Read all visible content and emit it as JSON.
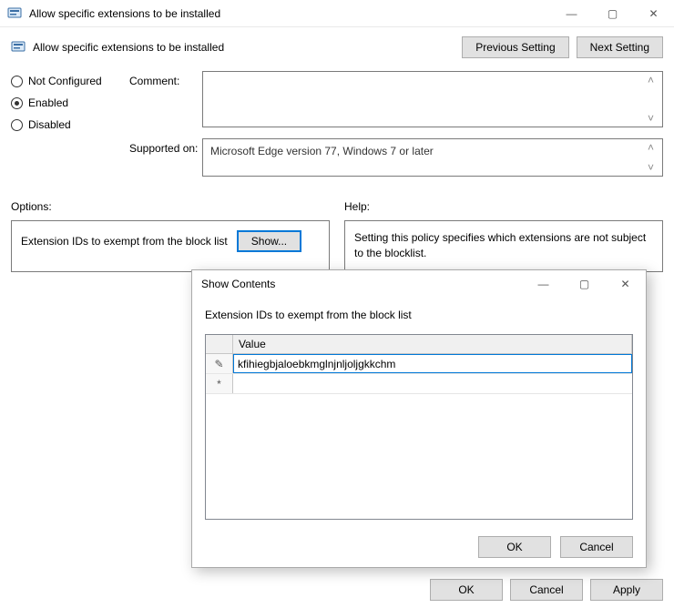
{
  "window": {
    "title": "Allow specific extensions to be installed",
    "controls": {
      "minimize": "—",
      "maximize": "▢",
      "close": "✕"
    }
  },
  "header": {
    "policy_title": "Allow specific extensions to be installed",
    "previous_setting": "Previous Setting",
    "next_setting": "Next Setting"
  },
  "state_radios": {
    "not_configured": "Not Configured",
    "enabled": "Enabled",
    "disabled": "Disabled",
    "selected": "enabled"
  },
  "comment": {
    "label": "Comment:",
    "value": ""
  },
  "supported": {
    "label": "Supported on:",
    "value": "Microsoft Edge version 77, Windows 7 or later"
  },
  "options": {
    "label": "Options:",
    "line": "Extension IDs to exempt from the block list",
    "show_button": "Show..."
  },
  "help": {
    "label": "Help:",
    "text": "Setting this policy specifies which extensions are not subject to the blocklist."
  },
  "dialog": {
    "title": "Show Contents",
    "caption": "Extension IDs to exempt from the block list",
    "column_header": "Value",
    "rows": [
      {
        "marker": "✎",
        "value": "kfihiegbjaloebkmglnjnljoljgkkchm"
      },
      {
        "marker": "*",
        "value": ""
      }
    ],
    "ok": "OK",
    "cancel": "Cancel"
  },
  "footer": {
    "ok": "OK",
    "cancel": "Cancel",
    "apply": "Apply"
  }
}
